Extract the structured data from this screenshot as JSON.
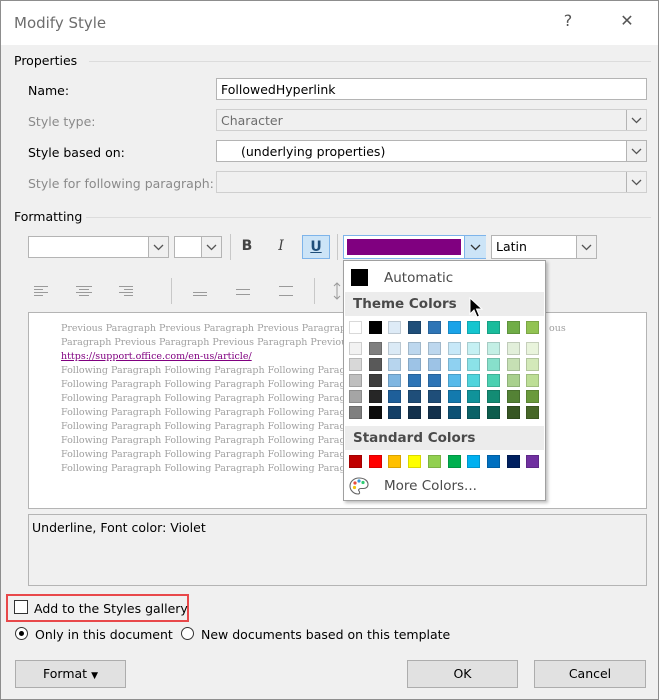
{
  "dialog": {
    "title": "Modify Style",
    "help_glyph": "?",
    "close_glyph": "✕"
  },
  "properties": {
    "group_label": "Properties",
    "name_label": "Name:",
    "name_value": "FollowedHyperlink",
    "style_type_label": "Style type:",
    "style_type_value": "Character",
    "based_on_label": "Style based on:",
    "based_on_value": "(underlying properties)",
    "following_label": "Style for following paragraph:",
    "following_value": ""
  },
  "formatting": {
    "group_label": "Formatting",
    "font_name": "",
    "font_size": "",
    "bold": "B",
    "italic": "I",
    "underline": "U",
    "font_color": "#800080",
    "script": "Latin"
  },
  "preview": {
    "previous_line_1": "Previous Paragraph Previous Paragraph Previous Paragraph",
    "previous_tail": "ous",
    "previous_line_2": "Paragraph Previous Paragraph Previous Paragraph Previous",
    "link_text": "https://support.office.com/en-us/article/",
    "following_line": "Following Paragraph Following Paragraph Following Paragra"
  },
  "description": "Underline, Font color: Violet",
  "color_picker": {
    "automatic_label": "Automatic",
    "theme_header": "Theme Colors",
    "standard_header": "Standard Colors",
    "more_colors_label": "More Colors...",
    "theme_top_row": [
      "#ffffff",
      "#000000",
      "#deebf7",
      "#1f4e79",
      "#2e75b6",
      "#1aa3e8",
      "#15c5cf",
      "#1abc9c",
      "#70ad47",
      "#92c353"
    ],
    "theme_shades": [
      [
        "#f2f2f2",
        "#7f7f7f",
        "#dbeaf6",
        "#bdd7ee",
        "#bdd7ee",
        "#c7e8f8",
        "#c5f0f3",
        "#c3efe5",
        "#e2efda",
        "#e9f4dc"
      ],
      [
        "#d8d8d8",
        "#595959",
        "#b7d5ee",
        "#9dc3e6",
        "#9dc3e6",
        "#8fd1f1",
        "#8be2e8",
        "#87e0cb",
        "#c6e0b4",
        "#d3e9b9"
      ],
      [
        "#bfbfbf",
        "#3f3f3f",
        "#7fb6e1",
        "#2e75b6",
        "#2e75b6",
        "#57baea",
        "#50d4dc",
        "#4bd0b1",
        "#a9d08e",
        "#bdde96"
      ],
      [
        "#a5a5a5",
        "#262626",
        "#1e5f9a",
        "#1f4e79",
        "#1f4e79",
        "#137aae",
        "#10939a",
        "#138c74",
        "#548235",
        "#6a9a3c"
      ],
      [
        "#7f7f7f",
        "#0c0c0c",
        "#143f66",
        "#13314c",
        "#13314c",
        "#0d5174",
        "#0a6267",
        "#0d5d4d",
        "#375623",
        "#476728"
      ]
    ],
    "standard_colors": [
      "#c00000",
      "#ff0000",
      "#ffc000",
      "#ffff00",
      "#92d050",
      "#00b050",
      "#00b0f0",
      "#0070c0",
      "#002060",
      "#7030a0"
    ]
  },
  "options": {
    "add_to_gallery_label": "Add to the Styles gallery",
    "only_this_doc_label": "Only in this document",
    "new_docs_label": "New documents based on this template"
  },
  "buttons": {
    "format": "Format",
    "ok": "OK",
    "cancel": "Cancel"
  },
  "highlight_color": "#e8484a"
}
